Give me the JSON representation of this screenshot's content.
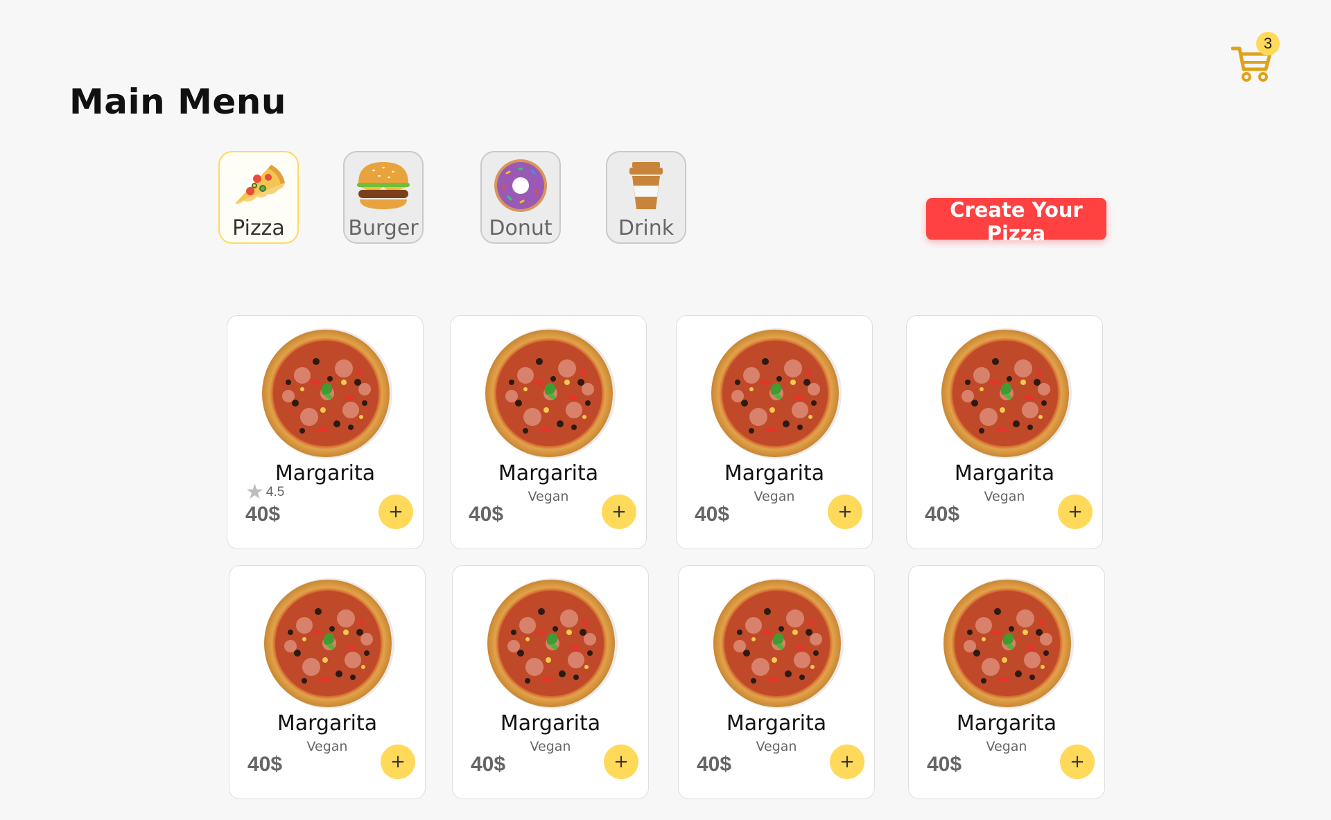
{
  "header": {
    "title": "Main Menu",
    "cart": {
      "icon": "cart-icon",
      "count": "3"
    }
  },
  "categories": [
    {
      "label": "Pizza",
      "icon": "pizza-icon",
      "active": true
    },
    {
      "label": "Burger",
      "icon": "burger-icon",
      "active": false
    },
    {
      "label": "Donut",
      "icon": "donut-icon",
      "active": false
    },
    {
      "label": "Drink",
      "icon": "drink-icon",
      "active": false
    }
  ],
  "create_button": {
    "label": "Create Your Pizza"
  },
  "products": [
    {
      "name": "Margarita",
      "rating": "4.5",
      "price": "40$",
      "add_label": "+"
    },
    {
      "name": "Margarita",
      "subtitle": "Vegan",
      "price": "40$",
      "add_label": "+"
    },
    {
      "name": "Margarita",
      "subtitle": "Vegan",
      "price": "40$",
      "add_label": "+"
    },
    {
      "name": "Margarita",
      "subtitle": "Vegan",
      "price": "40$",
      "add_label": "+"
    },
    {
      "name": "Margarita",
      "subtitle": "Vegan",
      "price": "40$",
      "add_label": "+"
    },
    {
      "name": "Margarita",
      "subtitle": "Vegan",
      "price": "40$",
      "add_label": "+"
    },
    {
      "name": "Margarita",
      "subtitle": "Vegan",
      "price": "40$",
      "add_label": "+"
    },
    {
      "name": "Margarita",
      "subtitle": "Vegan",
      "price": "40$",
      "add_label": "+"
    }
  ],
  "colors": {
    "accent_yellow": "#ffd95a",
    "create_button": "#ff4141",
    "cart": "#e0a21a",
    "background": "#f7f7f7"
  }
}
